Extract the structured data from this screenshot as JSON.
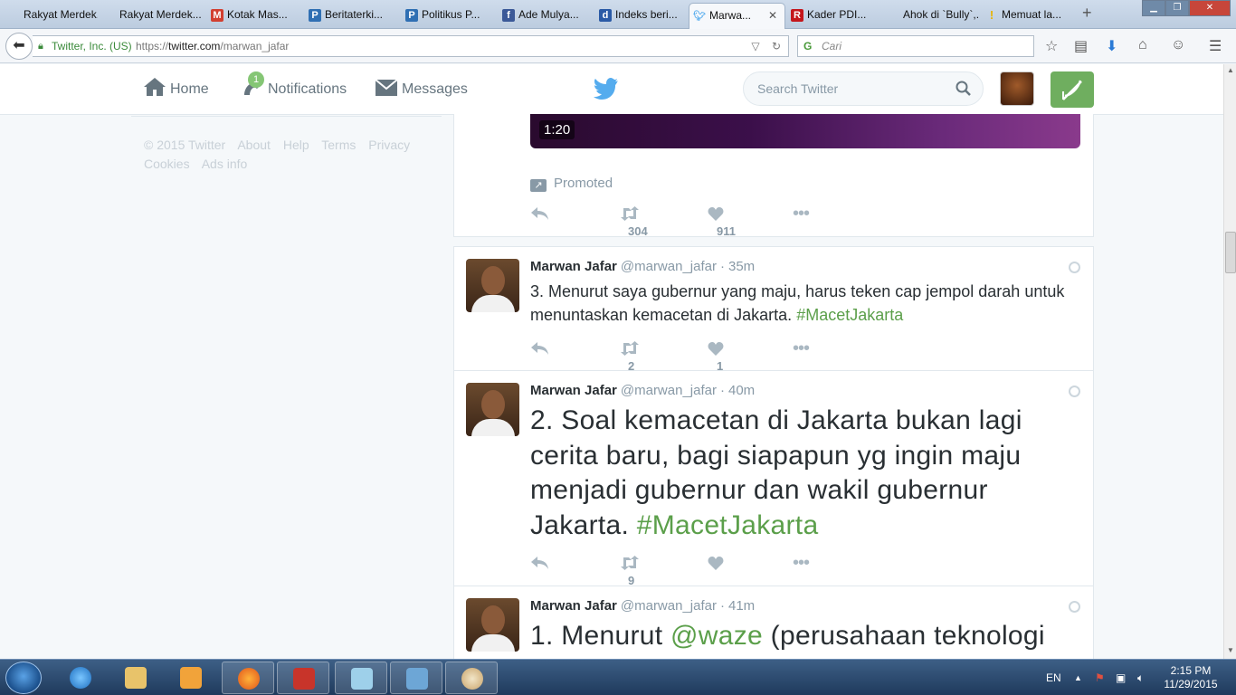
{
  "browser": {
    "tabs": [
      {
        "label": "Rakyat Merdek...",
        "favicon": "none",
        "color": "#ffffff"
      },
      {
        "label": "Rakyat Merdek...",
        "favicon": "none",
        "color": "#ffffff"
      },
      {
        "label": "Kotak Mas...",
        "favicon": "gmail-icon",
        "color": "#d23f31"
      },
      {
        "label": "Beritaterki...",
        "favicon": "blog-icon",
        "color": "#2f6fb3"
      },
      {
        "label": "Politikus P...",
        "favicon": "blog-icon",
        "color": "#2f6fb3"
      },
      {
        "label": "Ade Mulya...",
        "favicon": "facebook-icon",
        "color": "#3b5998"
      },
      {
        "label": "Indeks beri...",
        "favicon": "detik-icon",
        "color": "#2a5aa6"
      },
      {
        "label": "Marwa...",
        "favicon": "twitter-icon",
        "color": "#55acee",
        "active": true
      },
      {
        "label": "Kader PDI...",
        "favicon": "rmol-icon",
        "color": "#c4161c"
      },
      {
        "label": "Ahok di `Bully`,...",
        "favicon": "none",
        "color": "#ffffff"
      },
      {
        "label": "Memuat la...",
        "favicon": "warning-icon",
        "color": "#e8b400"
      }
    ],
    "close_glyph": "✕",
    "new_tab_glyph": "+",
    "identity": "Twitter, Inc. (US)",
    "url_prefix": "https://",
    "url_domain": "twitter.com",
    "url_path": "/marwan_jafar",
    "search_placeholder": "Cari"
  },
  "twitter": {
    "nav": {
      "home": "Home",
      "notifications": "Notifications",
      "notifications_badge": "1",
      "messages": "Messages"
    },
    "search_placeholder": "Search Twitter",
    "accent": "#5b9f4a",
    "footer": {
      "copyright": "© 2015 Twitter",
      "about": "About",
      "help": "Help",
      "terms": "Terms",
      "privacy": "Privacy",
      "cookies": "Cookies",
      "ads_info": "Ads info"
    },
    "promoted_tweet": {
      "video_duration": "1:20",
      "promoted_label": "Promoted",
      "retweets": "304",
      "likes": "911"
    },
    "tweets": [
      {
        "name": "Marwan Jafar",
        "handle": "@marwan_jafar",
        "time": "35m",
        "text": "3. Menurut saya gubernur yang maju, harus teken cap jempol darah untuk menuntaskan kemacetan di Jakarta.",
        "hashtag": "#MacetJakarta",
        "retweets": "2",
        "likes": "1"
      },
      {
        "name": "Marwan Jafar",
        "handle": "@marwan_jafar",
        "time": "40m",
        "text": "2. Soal kemacetan di Jakarta bukan lagi cerita baru, bagi siapapun yg ingin maju menjadi gubernur dan wakil gubernur Jakarta.",
        "hashtag": "#MacetJakarta",
        "retweets": "9",
        "likes": ""
      },
      {
        "name": "Marwan Jafar",
        "handle": "@marwan_jafar",
        "time": "41m",
        "text_before": "1. Menurut ",
        "mention": "@waze",
        "text_after": " (perusahaan teknologi"
      }
    ]
  },
  "taskbar": {
    "language": "EN",
    "time": "2:15 PM",
    "date": "11/29/2015"
  }
}
